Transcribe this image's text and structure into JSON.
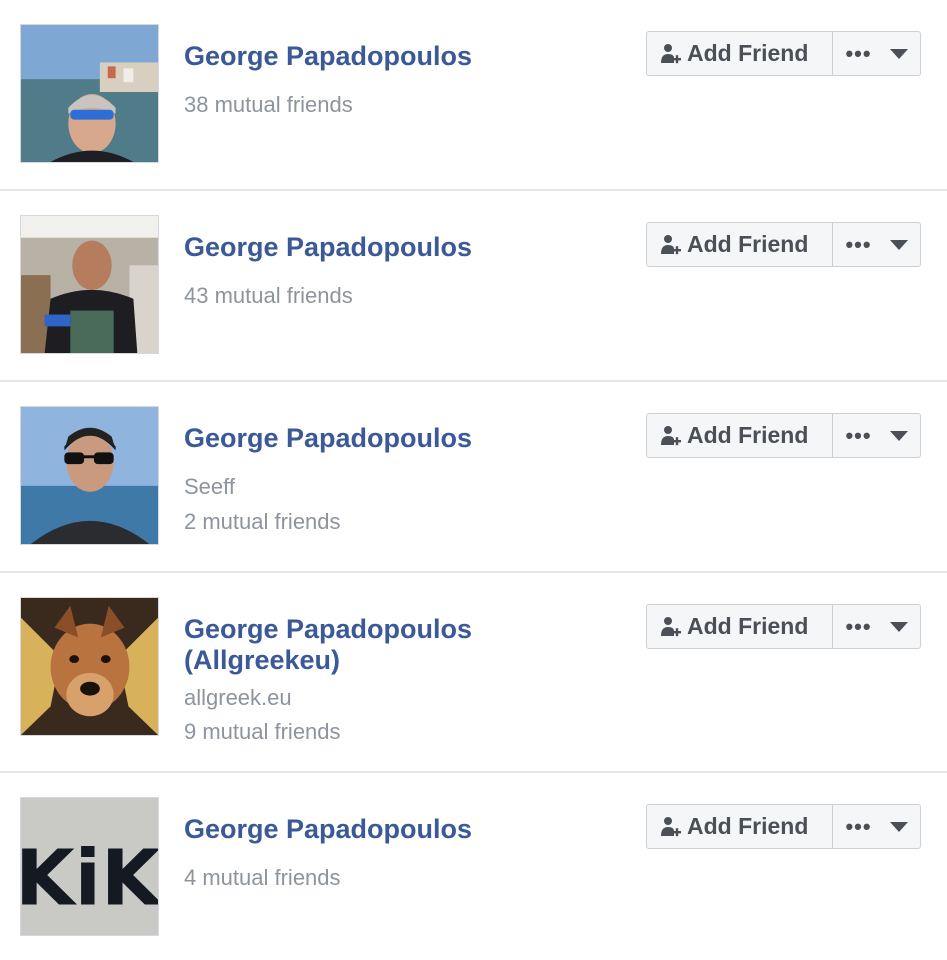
{
  "results": [
    {
      "name": "George Papadopoulos",
      "lines": [
        "38 mutual friends"
      ],
      "photo": "person-sunglasses-seaside-town",
      "add_friend_label": "Add Friend"
    },
    {
      "name": "George Papadopoulos",
      "lines": [
        "43 mutual friends"
      ],
      "photo": "person-apron-kitchen",
      "add_friend_label": "Add Friend"
    },
    {
      "name": "George Papadopoulos",
      "lines": [
        "Seeff",
        "2 mutual friends"
      ],
      "photo": "person-sunglasses-sea",
      "add_friend_label": "Add Friend"
    },
    {
      "name": "George Papadopoulos (Allgreekeu)",
      "lines": [
        "allgreek.eu",
        "9 mutual friends"
      ],
      "photo": "dog-with-wings",
      "add_friend_label": "Add Friend"
    },
    {
      "name": "George Papadopoulos",
      "lines": [
        "4 mutual friends"
      ],
      "photo": "kiki-letters-sign",
      "photo_text": "KiKI",
      "add_friend_label": "Add Friend"
    }
  ],
  "more_button_glyph": "•••",
  "colors": {
    "name_link": "#3b5998",
    "secondary_text": "#8d949e",
    "button_bg": "#f5f6f7",
    "button_border": "#ccd0d5",
    "divider": "#e5e6ea"
  }
}
